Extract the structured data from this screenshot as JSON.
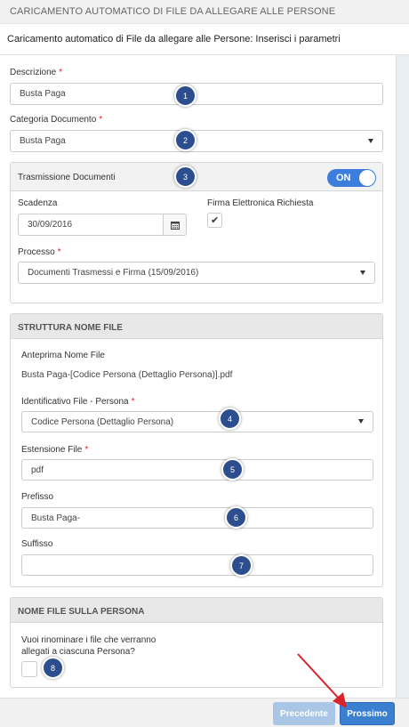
{
  "header": {
    "title": "CARICAMENTO AUTOMATICO DI FILE DA ALLEGARE ALLE PERSONE"
  },
  "subheader": {
    "text": "Caricamento automatico di File da allegare alle Persone: Inserisci i parametri"
  },
  "form": {
    "descrizione": {
      "label": "Descrizione",
      "required": "*",
      "value": "Busta Paga"
    },
    "categoria": {
      "label": "Categoria Documento",
      "required": "*",
      "value": "Busta Paga"
    }
  },
  "trasmissione": {
    "title": "Trasmissione Documenti",
    "toggle_label": "ON",
    "scadenza": {
      "label": "Scadenza",
      "value": "30/09/2016"
    },
    "firma": {
      "label": "Firma Elettronica Richiesta",
      "checked": true,
      "check_glyph": "✔"
    },
    "processo": {
      "label": "Processo",
      "required": "*",
      "value": "Documenti Trasmessi e Firma (15/09/2016)"
    }
  },
  "struttura": {
    "title": "STRUTTURA NOME FILE",
    "anteprima_label": "Anteprima Nome File",
    "anteprima_value": "Busta Paga-[Codice Persona (Dettaglio Persona)].pdf",
    "identificativo": {
      "label": "Identificativo File - Persona",
      "required": "*",
      "value": "Codice Persona (Dettaglio Persona)"
    },
    "estensione": {
      "label": "Estensione File",
      "required": "*",
      "value": "pdf"
    },
    "prefisso": {
      "label": "Prefisso",
      "value": "Busta Paga-"
    },
    "suffisso": {
      "label": "Suffisso",
      "value": ""
    }
  },
  "nome_file": {
    "title": "NOME FILE SULLA PERSONA",
    "question_line1": "Vuoi rinominare i file che verranno",
    "question_line2": "allegati a ciascuna Persona?",
    "checked": false
  },
  "markers": [
    "1",
    "2",
    "3",
    "4",
    "5",
    "6",
    "7",
    "8"
  ],
  "footer": {
    "prev_label": "Precedente",
    "next_label": "Prossimo"
  },
  "colors": {
    "primary": "#3a7fd0",
    "marker": "#2d4e8e",
    "required": "#d9232d",
    "arrow": "#d9232d"
  },
  "icons": {
    "calendar": "calendar-icon",
    "caret": "chevron-down-icon",
    "check": "check-icon",
    "arrow": "red-arrow-annotation"
  }
}
